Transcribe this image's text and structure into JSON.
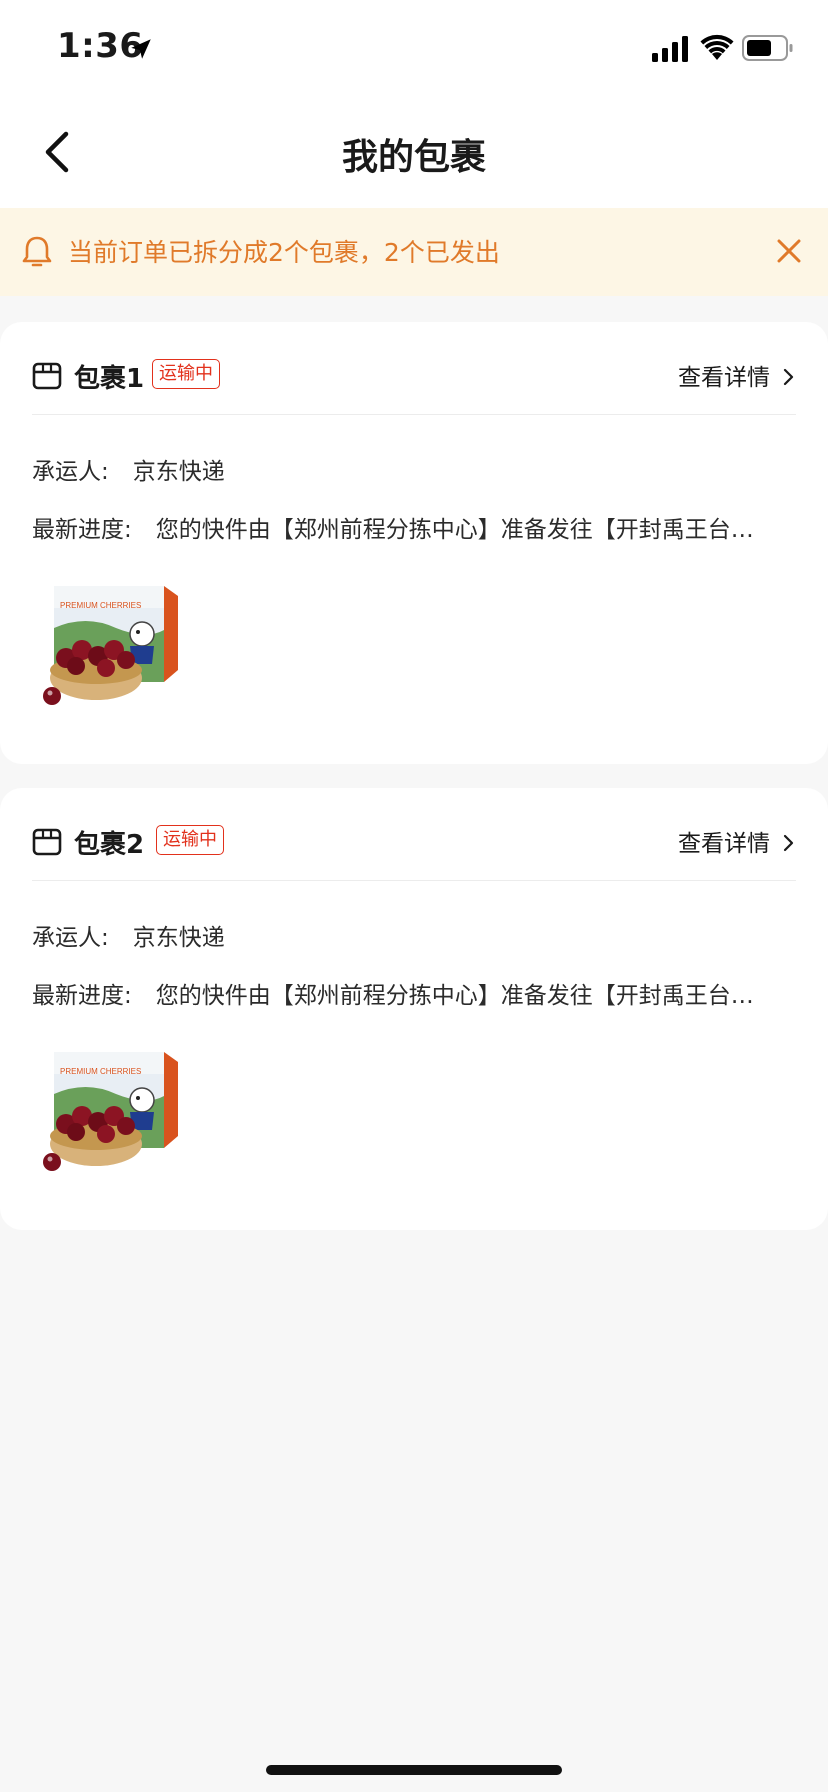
{
  "status": {
    "time": "1:36"
  },
  "nav": {
    "title": "我的包裹"
  },
  "notice": {
    "text": "当前订单已拆分成2个包裹，2个已发出"
  },
  "packages": [
    {
      "name": "包裹1",
      "status": "运输中",
      "detail_label": "查看详情",
      "carrier_label": "承运人:",
      "carrier": "京东快递",
      "progress_label": "最新进度:",
      "progress": "您的快件由【郑州前程分拣中心】准备发往【开封禹王台…",
      "product_image_label": "PREMIUM CHERRIES"
    },
    {
      "name": "包裹2",
      "status": "运输中",
      "detail_label": "查看详情",
      "carrier_label": "承运人:",
      "carrier": "京东快递",
      "progress_label": "最新进度:",
      "progress": "您的快件由【郑州前程分拣中心】准备发往【开封禹王台…",
      "product_image_label": "PREMIUM CHERRIES"
    }
  ],
  "colors": {
    "accent": "#e2311c",
    "notice_text": "#e07a2a",
    "notice_bg": "#fdf6e5"
  }
}
